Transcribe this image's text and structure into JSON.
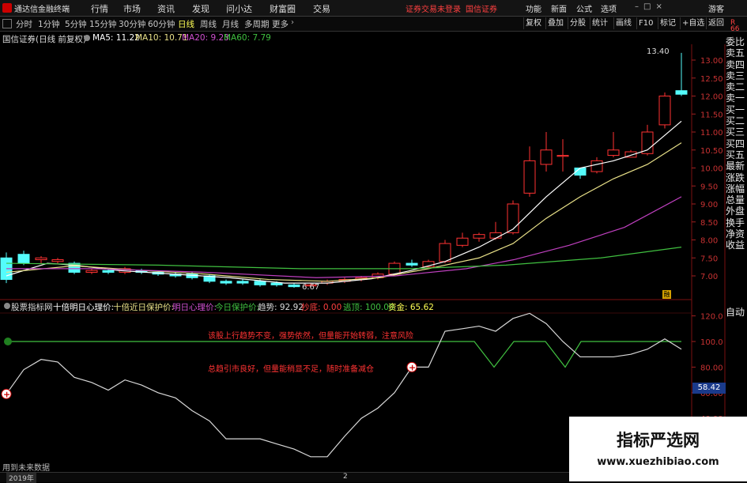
{
  "app": {
    "name": "通达信金融终端",
    "menu": [
      "行情",
      "市场",
      "资讯",
      "发现",
      "问小达",
      "财富圈",
      "交易"
    ],
    "login_status": "证券交易未登录",
    "broker_link": "国信证券",
    "right_menu": [
      "功能",
      "新面",
      "公式",
      "选项"
    ],
    "guest": "游客"
  },
  "period_bar": {
    "periods": [
      "分时",
      "1分钟",
      "5分钟",
      "15分钟",
      "30分钟",
      "60分钟",
      "日线",
      "周线",
      "月线",
      "多周期",
      "更多"
    ],
    "active": "日线",
    "tools": [
      "复权",
      "叠加",
      "分股",
      "统计",
      "画线",
      "F10",
      "标记",
      "+自选",
      "返回"
    ]
  },
  "main_info": {
    "stock": "国信证券(日线 前复权)",
    "ma5": "MA5: 11.22",
    "ma10": "MA10: 10.71",
    "ma20": "MA20: 9.23",
    "ma60": "MA60: 7.79",
    "high_label": "13.40",
    "low_label": "6.67",
    "r_label": "R",
    "bar_count": "66",
    "lock_label": "融"
  },
  "price_axis": [
    "13.00",
    "12.50",
    "12.00",
    "11.50",
    "11.00",
    "10.50",
    "10.00",
    "9.50",
    "9.00",
    "8.50",
    "8.00",
    "7.50",
    "7.00"
  ],
  "side_quotes": [
    "委比",
    "卖五",
    "卖四",
    "卖三",
    "卖二",
    "卖一",
    "买一",
    "买二",
    "买三",
    "买四",
    "买五",
    "最新",
    "涨跌",
    "涨幅",
    "总量",
    "外盘",
    "换手",
    "净资",
    "收益"
  ],
  "indicator": {
    "name": "股票指标网",
    "line1": "十倍明日心理价:",
    "line2": "十倍近日保护价:",
    "line3": "明日心理价:",
    "line4": "今日保护价:",
    "trend": "趋势: 92.92",
    "bottom": "抄底: 0.00",
    "escape": "逃顶: 100.00",
    "capital": "资金: 65.62",
    "note1": "该股上行趋势不变，强势依然，但量能开始转弱，注意风险",
    "note2": "总趋引市良好，但量能稍显不足，随时准备减仓",
    "auto": "自动",
    "current_value": "58.42",
    "axis": [
      "120.0",
      "100.0",
      "80.00",
      "60.00",
      "40.00"
    ],
    "date_label": "2019年",
    "date_mark": "2",
    "future_label": "用到未来数据"
  },
  "watermark": {
    "title": "指标严选网",
    "url": "www.xuezhibiao.com"
  },
  "colors": {
    "up": "#ff3232",
    "down": "#54fcfc",
    "ma5": "#ffffff",
    "ma10": "#e8e088",
    "ma20": "#c040c0",
    "ma60": "#40c040",
    "accent": "#ffff00"
  }
}
